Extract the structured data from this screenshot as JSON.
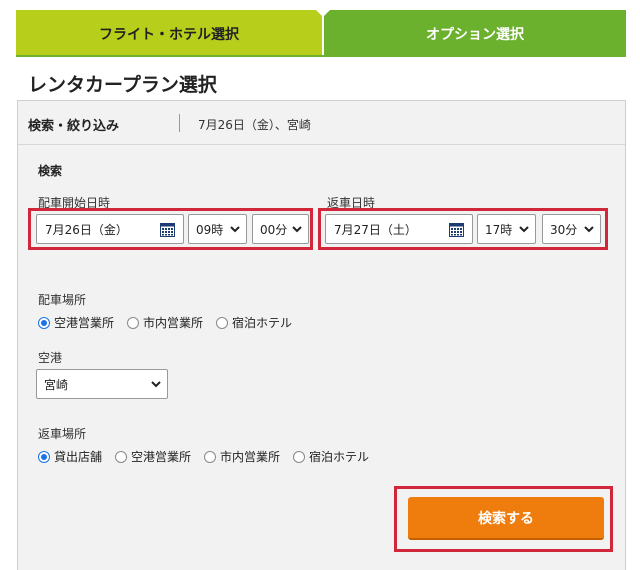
{
  "tabs": {
    "flight_hotel": "フライト・ホテル選択",
    "options": "オプション選択"
  },
  "page_title": "レンタカープラン選択",
  "panel_header": {
    "label": "検索・絞り込み",
    "summary": "7月26日（金）、宮崎"
  },
  "search": {
    "section_title": "検索",
    "pickup": {
      "label": "配車開始日時",
      "date": "7月26日（金）",
      "hour": "09時",
      "minute": "00分"
    },
    "return": {
      "label": "返車日時",
      "date": "7月27日（土）",
      "hour": "17時",
      "minute": "30分"
    },
    "pickup_place": {
      "label": "配車場所",
      "options": [
        "空港営業所",
        "市内営業所",
        "宿泊ホテル"
      ],
      "selected_index": 0
    },
    "airport": {
      "label": "空港",
      "selected": "宮崎"
    },
    "return_place": {
      "label": "返車場所",
      "options": [
        "貸出店舗",
        "空港営業所",
        "市内営業所",
        "宿泊ホテル"
      ],
      "selected_index": 0
    },
    "submit_label": "検索する"
  },
  "colors": {
    "tab_inactive": "#b7cf1a",
    "tab_active": "#6cb12e",
    "highlight": "#d0283a",
    "button": "#ef7d0e",
    "radio_selected": "#1a73e8"
  }
}
